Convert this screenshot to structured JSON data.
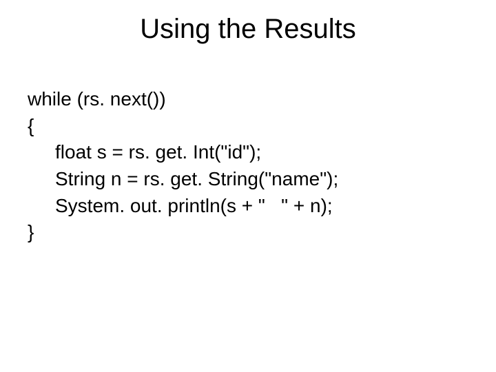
{
  "title": "Using the Results",
  "code": {
    "l1": "while (rs. next())",
    "l2": "{",
    "l3": "float s = rs. get. Int(\"id\");",
    "l4": "String n = rs. get. String(\"name\");",
    "l5": "System. out. println(s + \"   \" + n);",
    "l6": "}"
  }
}
